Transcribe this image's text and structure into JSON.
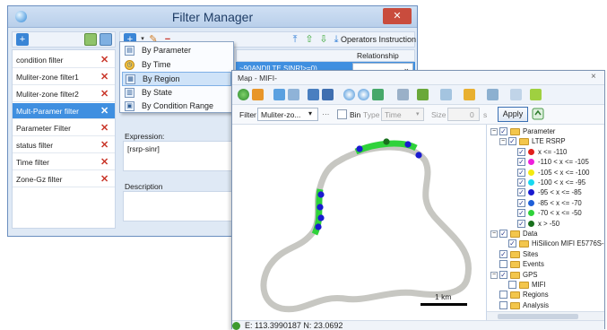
{
  "filter_manager": {
    "title": "Filter Manager",
    "close_glyph": "✕",
    "add_glyph": "+",
    "delete_glyph": "✕",
    "items": [
      {
        "label": "condition filter",
        "selected": false
      },
      {
        "label": "Muliter-zone filter1",
        "selected": false
      },
      {
        "label": "Muliter-zone filter2",
        "selected": false
      },
      {
        "label": "Mult-Paramer filter",
        "selected": true
      },
      {
        "label": "Parameter Filter",
        "selected": false
      },
      {
        "label": "status filter",
        "selected": false
      },
      {
        "label": "Time filter",
        "selected": false
      },
      {
        "label": "Zone-Gz filter",
        "selected": false
      }
    ],
    "operators_label": "Operators Instruction",
    "relationship_header": "Relationship",
    "row_expression": "~90AND[LTE SINR]>=0)",
    "expression_label": "Expression:",
    "expression_value": "[rsrp-sinr]",
    "description_label": "Description"
  },
  "menu": {
    "items": [
      {
        "label": "By Parameter",
        "icon": "parameter-icon",
        "highlighted": false
      },
      {
        "label": "By Time",
        "icon": "clock-icon",
        "highlighted": false
      },
      {
        "label": "By Region",
        "icon": "region-icon",
        "highlighted": true
      },
      {
        "label": "By State",
        "icon": "state-icon",
        "highlighted": false
      },
      {
        "label": "By Condition Range",
        "icon": "range-icon",
        "highlighted": false
      }
    ]
  },
  "map": {
    "title": "Map - MIFI-",
    "close_glyph": "×",
    "filter_label": "Filter",
    "filter_value": "Muliter-zo...",
    "filter_more": "···",
    "bin_label": "Bin",
    "type_label": "Type",
    "type_value": "Time",
    "size_label": "Size",
    "size_value": "0",
    "size_unit": "s",
    "apply_label": "Apply",
    "scale_label": "1 km",
    "coords": "E:  113.3990187  N:  23.0692"
  },
  "tree": {
    "nodes": [
      {
        "label": "Parameter",
        "level": 0,
        "expander": "−",
        "checked": true,
        "kind": "folder"
      },
      {
        "label": "LTE RSRP",
        "level": 1,
        "expander": "−",
        "checked": true,
        "kind": "folder"
      },
      {
        "label": "x <= -110",
        "level": 2,
        "checked": true,
        "kind": "legend",
        "color": "#e0201c"
      },
      {
        "label": "-110 < x <= -105",
        "level": 2,
        "checked": true,
        "kind": "legend",
        "color": "#ee1fdc"
      },
      {
        "label": "-105 < x <= -100",
        "level": 2,
        "checked": true,
        "kind": "legend",
        "color": "#f4ea10"
      },
      {
        "label": "-100 < x <= -95",
        "level": 2,
        "checked": true,
        "kind": "legend",
        "color": "#18d8f0"
      },
      {
        "label": "-95 < x <= -85",
        "level": 2,
        "checked": true,
        "kind": "legend",
        "color": "#1a1ad0"
      },
      {
        "label": "-85 < x <= -70",
        "level": 2,
        "checked": true,
        "kind": "legend",
        "color": "#1f5fd8"
      },
      {
        "label": "-70 < x <= -50",
        "level": 2,
        "checked": true,
        "kind": "legend",
        "color": "#2fd23a"
      },
      {
        "label": "x > -50",
        "level": 2,
        "checked": true,
        "kind": "legend",
        "color": "#18701c"
      },
      {
        "label": "Data",
        "level": 0,
        "expander": "−",
        "checked": true,
        "kind": "folder"
      },
      {
        "label": "HiSilicon MIFI E5776S-",
        "level": 1,
        "checked": true,
        "kind": "folder"
      },
      {
        "label": "Sites",
        "level": 0,
        "checked": true,
        "kind": "folder"
      },
      {
        "label": "Events",
        "level": 0,
        "checked": false,
        "kind": "folder"
      },
      {
        "label": "GPS",
        "level": 0,
        "expander": "−",
        "checked": true,
        "kind": "folder"
      },
      {
        "label": "MIFI",
        "level": 1,
        "checked": false,
        "kind": "folder"
      },
      {
        "label": "Regions",
        "level": 0,
        "checked": false,
        "kind": "folder"
      },
      {
        "label": "Analysis",
        "level": 0,
        "checked": false,
        "kind": "folder"
      }
    ]
  }
}
